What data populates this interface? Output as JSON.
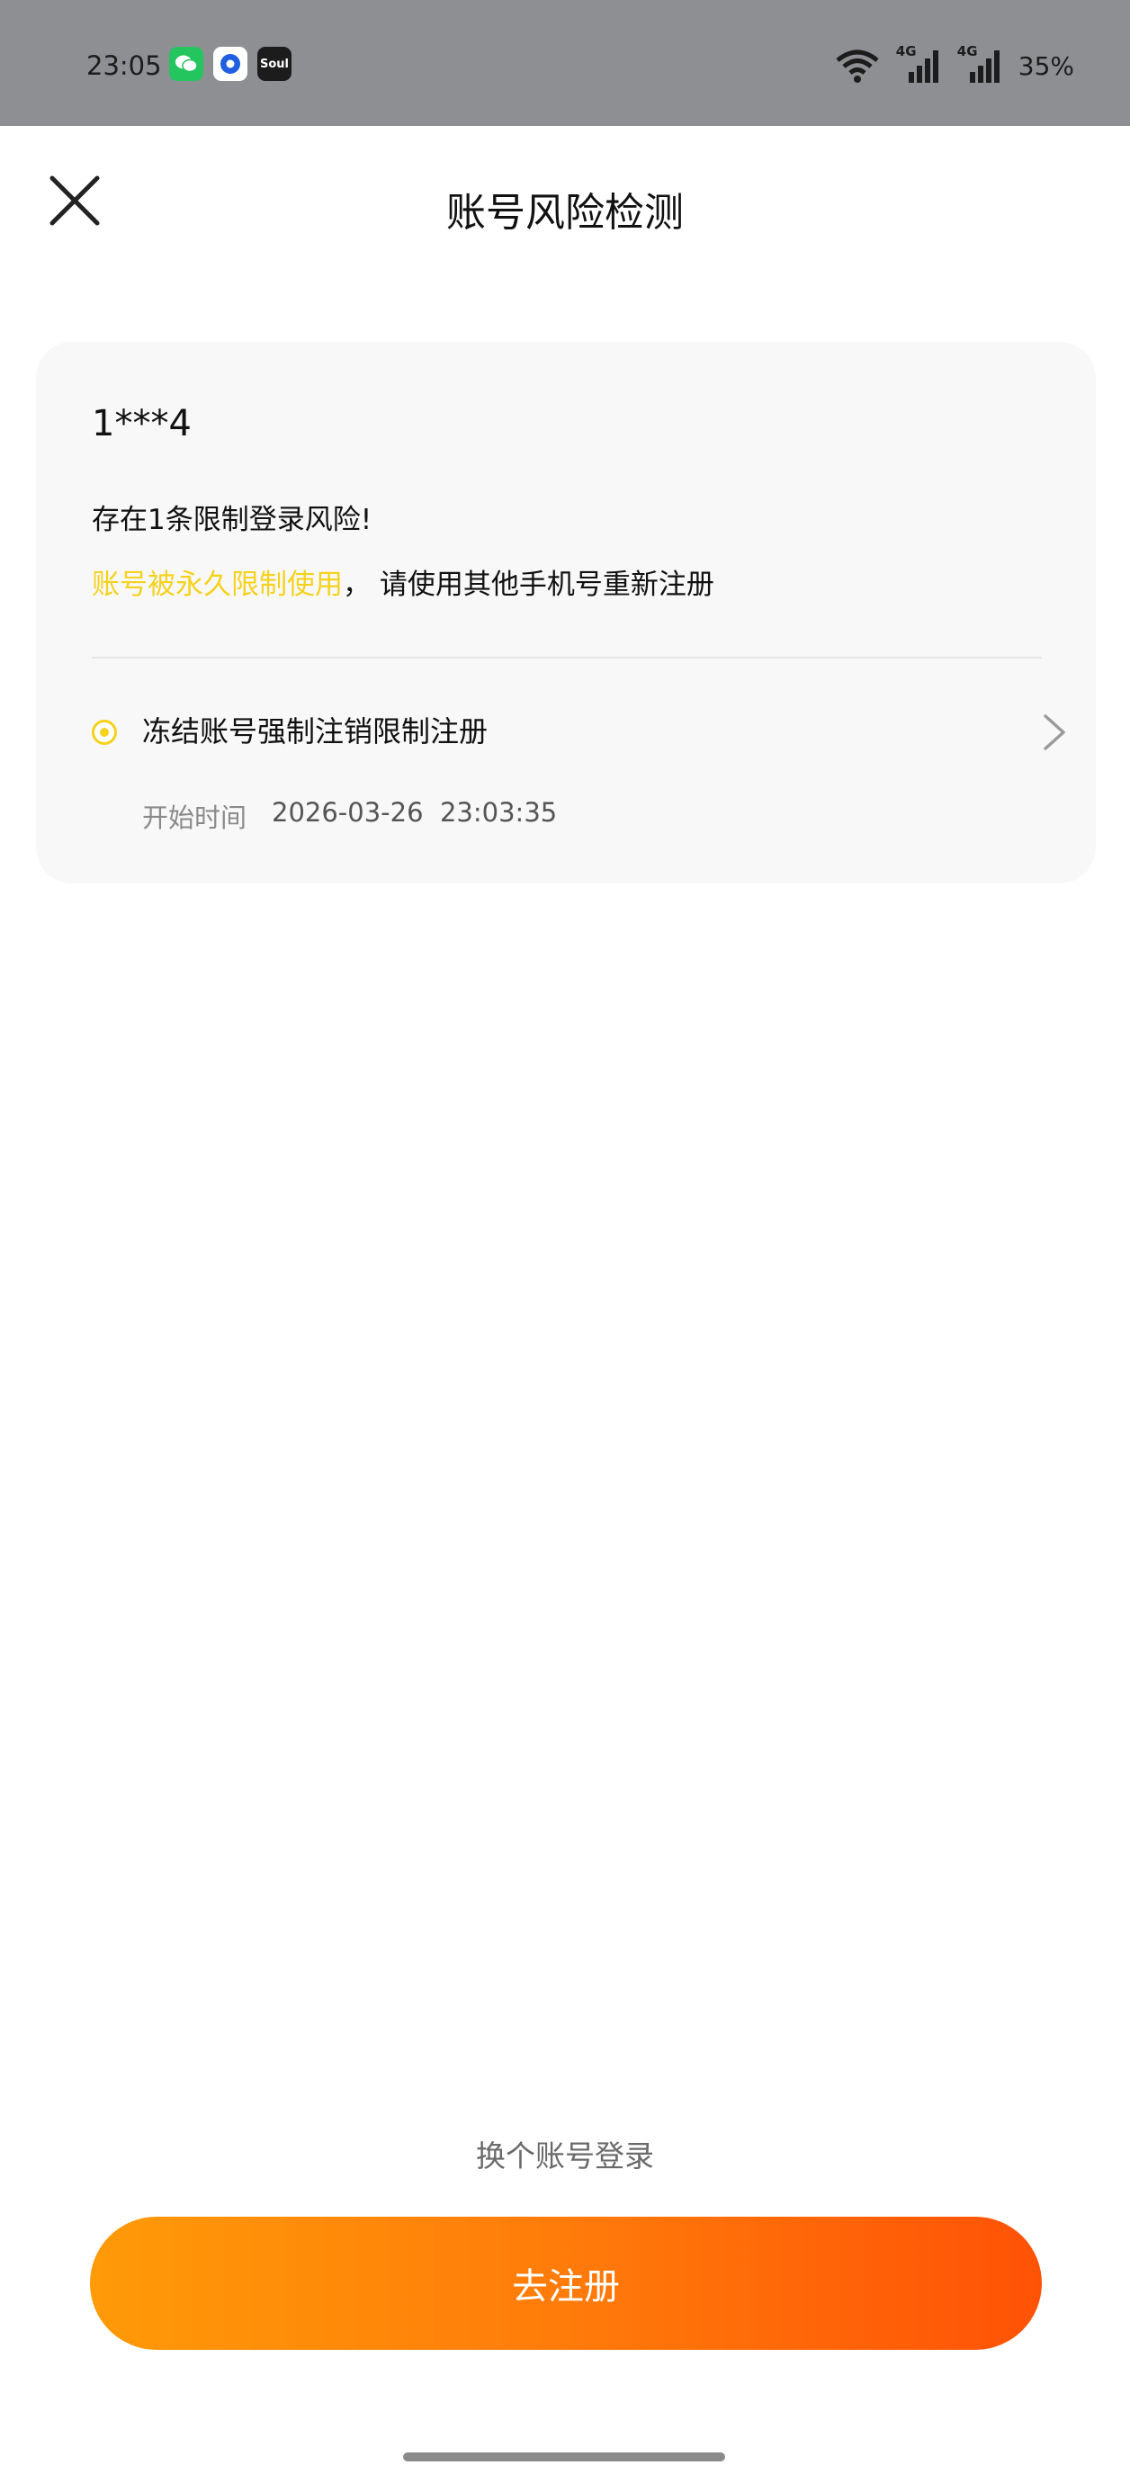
{
  "status_bar": {
    "time": "23:05",
    "app_icons": [
      "wechat-icon",
      "blue-app-icon",
      "soul-app-icon"
    ],
    "soul_label": "Soul",
    "network_1": "4G",
    "network_2": "4G",
    "battery": "35%"
  },
  "header": {
    "title": "账号风险检测",
    "close_icon": "close-icon"
  },
  "card": {
    "account": "1***4",
    "risk_count": "存在1条限制登录风险!",
    "risk_highlight": "账号被永久限制使用",
    "risk_separator": "，",
    "risk_advice": "请使用其他手机号重新注册",
    "item": {
      "title": "冻结账号强制注销限制注册",
      "time_label": "开始时间",
      "time_value": "2026-03-26  23:03:35"
    }
  },
  "actions": {
    "switch_account": "换个账号登录",
    "register": "去注册"
  },
  "colors": {
    "highlight": "#f6d21c",
    "button_start": "#ff9a08",
    "button_end": "#ff5206",
    "status_bar": "#8e8f93"
  }
}
